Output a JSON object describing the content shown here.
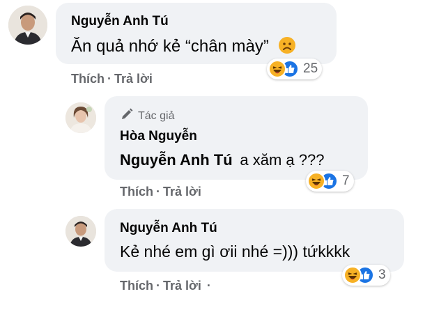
{
  "comments": [
    {
      "author": "Nguyễn Anh Tú",
      "text": "Ăn quả nhớ kẻ “chân mày”",
      "emoji": "🙁",
      "actions": {
        "like": "Thích",
        "separator": "·",
        "reply": "Trả lời"
      },
      "reaction_count": "25"
    },
    {
      "badge": "Tác giả",
      "author": "Hòa Nguyễn",
      "mention": "Nguyễn Anh Tú",
      "text": "a xăm ạ ???",
      "actions": {
        "like": "Thích",
        "separator": "·",
        "reply": "Trả lời"
      },
      "reaction_count": "7"
    },
    {
      "author": "Nguyễn Anh Tú",
      "text": "Kẻ nhé em gì ơii nhé =))) tứkkkk",
      "actions": {
        "like": "Thích",
        "separator": "·",
        "reply": "Trả lời"
      },
      "reaction_count": "3"
    }
  ],
  "icons": {
    "haha": "haha-reaction-icon",
    "like": "like-reaction-icon",
    "pencil": "pencil-icon",
    "frown": "frowning-emoji"
  },
  "colors": {
    "bubble": "#f0f2f5",
    "meta_text": "#65676b",
    "like_blue": "#1b74e4",
    "haha_yellow": "#f7b125"
  }
}
